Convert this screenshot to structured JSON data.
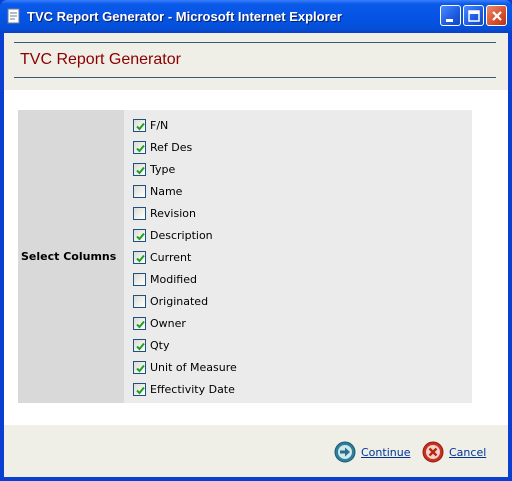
{
  "window": {
    "title": "TVC Report Generator - Microsoft Internet Explorer",
    "colors": {
      "titlebar": "#0654e6",
      "close_button": "#d6502c"
    }
  },
  "page": {
    "title": "TVC Report Generator",
    "title_color": "#8b0000"
  },
  "form": {
    "row_label": "Select Columns",
    "options": [
      {
        "label": "F/N",
        "checked": true
      },
      {
        "label": "Ref Des",
        "checked": true
      },
      {
        "label": "Type",
        "checked": true
      },
      {
        "label": "Name",
        "checked": false
      },
      {
        "label": "Revision",
        "checked": false
      },
      {
        "label": "Description",
        "checked": true
      },
      {
        "label": "Current",
        "checked": true
      },
      {
        "label": "Modified",
        "checked": false
      },
      {
        "label": "Originated",
        "checked": false
      },
      {
        "label": "Owner",
        "checked": true
      },
      {
        "label": "Qty",
        "checked": true
      },
      {
        "label": "Unit of Measure",
        "checked": true
      },
      {
        "label": "Effectivity Date",
        "checked": true
      }
    ]
  },
  "footer": {
    "continue_label": "Continue",
    "cancel_label": "Cancel",
    "continue_icon": "arrow-right-circle-icon",
    "cancel_icon": "x-circle-icon"
  }
}
